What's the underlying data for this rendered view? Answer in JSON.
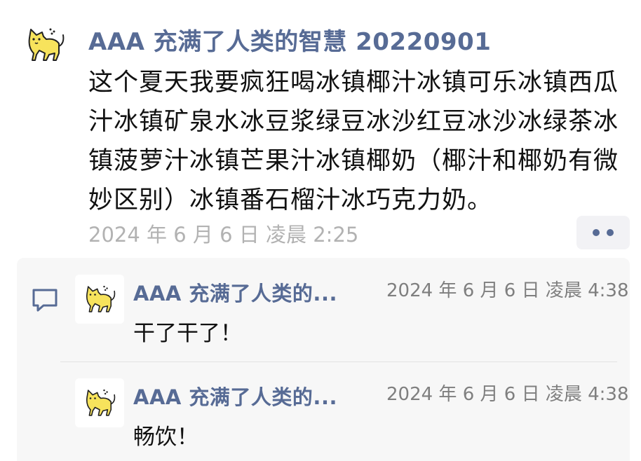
{
  "post": {
    "author": "AAA 充满了人类的智慧 20220901",
    "content": "这个夏天我要疯狂喝冰镇椰汁冰镇可乐冰镇西瓜汁冰镇矿泉水冰豆浆绿豆冰沙红豆冰沙冰绿茶冰镇菠萝汁冰镇芒果汁冰镇椰奶（椰汁和椰奶有微妙区别）冰镇番石榴汁冰巧克力奶。",
    "time": "2024 年 6 月 6 日 凌晨 2:25",
    "avatar_icon": "yellow-cat-avatar"
  },
  "more_button": {
    "icon": "two-dots-icon"
  },
  "comments": [
    {
      "author": "AAA 充满了人类的...",
      "time": "2024 年 6 月 6 日 凌晨 4:38",
      "text": "干了干了！",
      "avatar_icon": "yellow-cat-avatar"
    },
    {
      "author": "AAA 充满了人类的...",
      "time": "2024 年 6 月 6 日 凌晨 4:38",
      "text": "畅饮！",
      "avatar_icon": "yellow-cat-avatar"
    }
  ],
  "colors": {
    "link_blue": "#576b95",
    "time_gray": "#b2b2b2",
    "panel_bg": "#f7f7f7",
    "cat_yellow": "#f7e35c"
  }
}
